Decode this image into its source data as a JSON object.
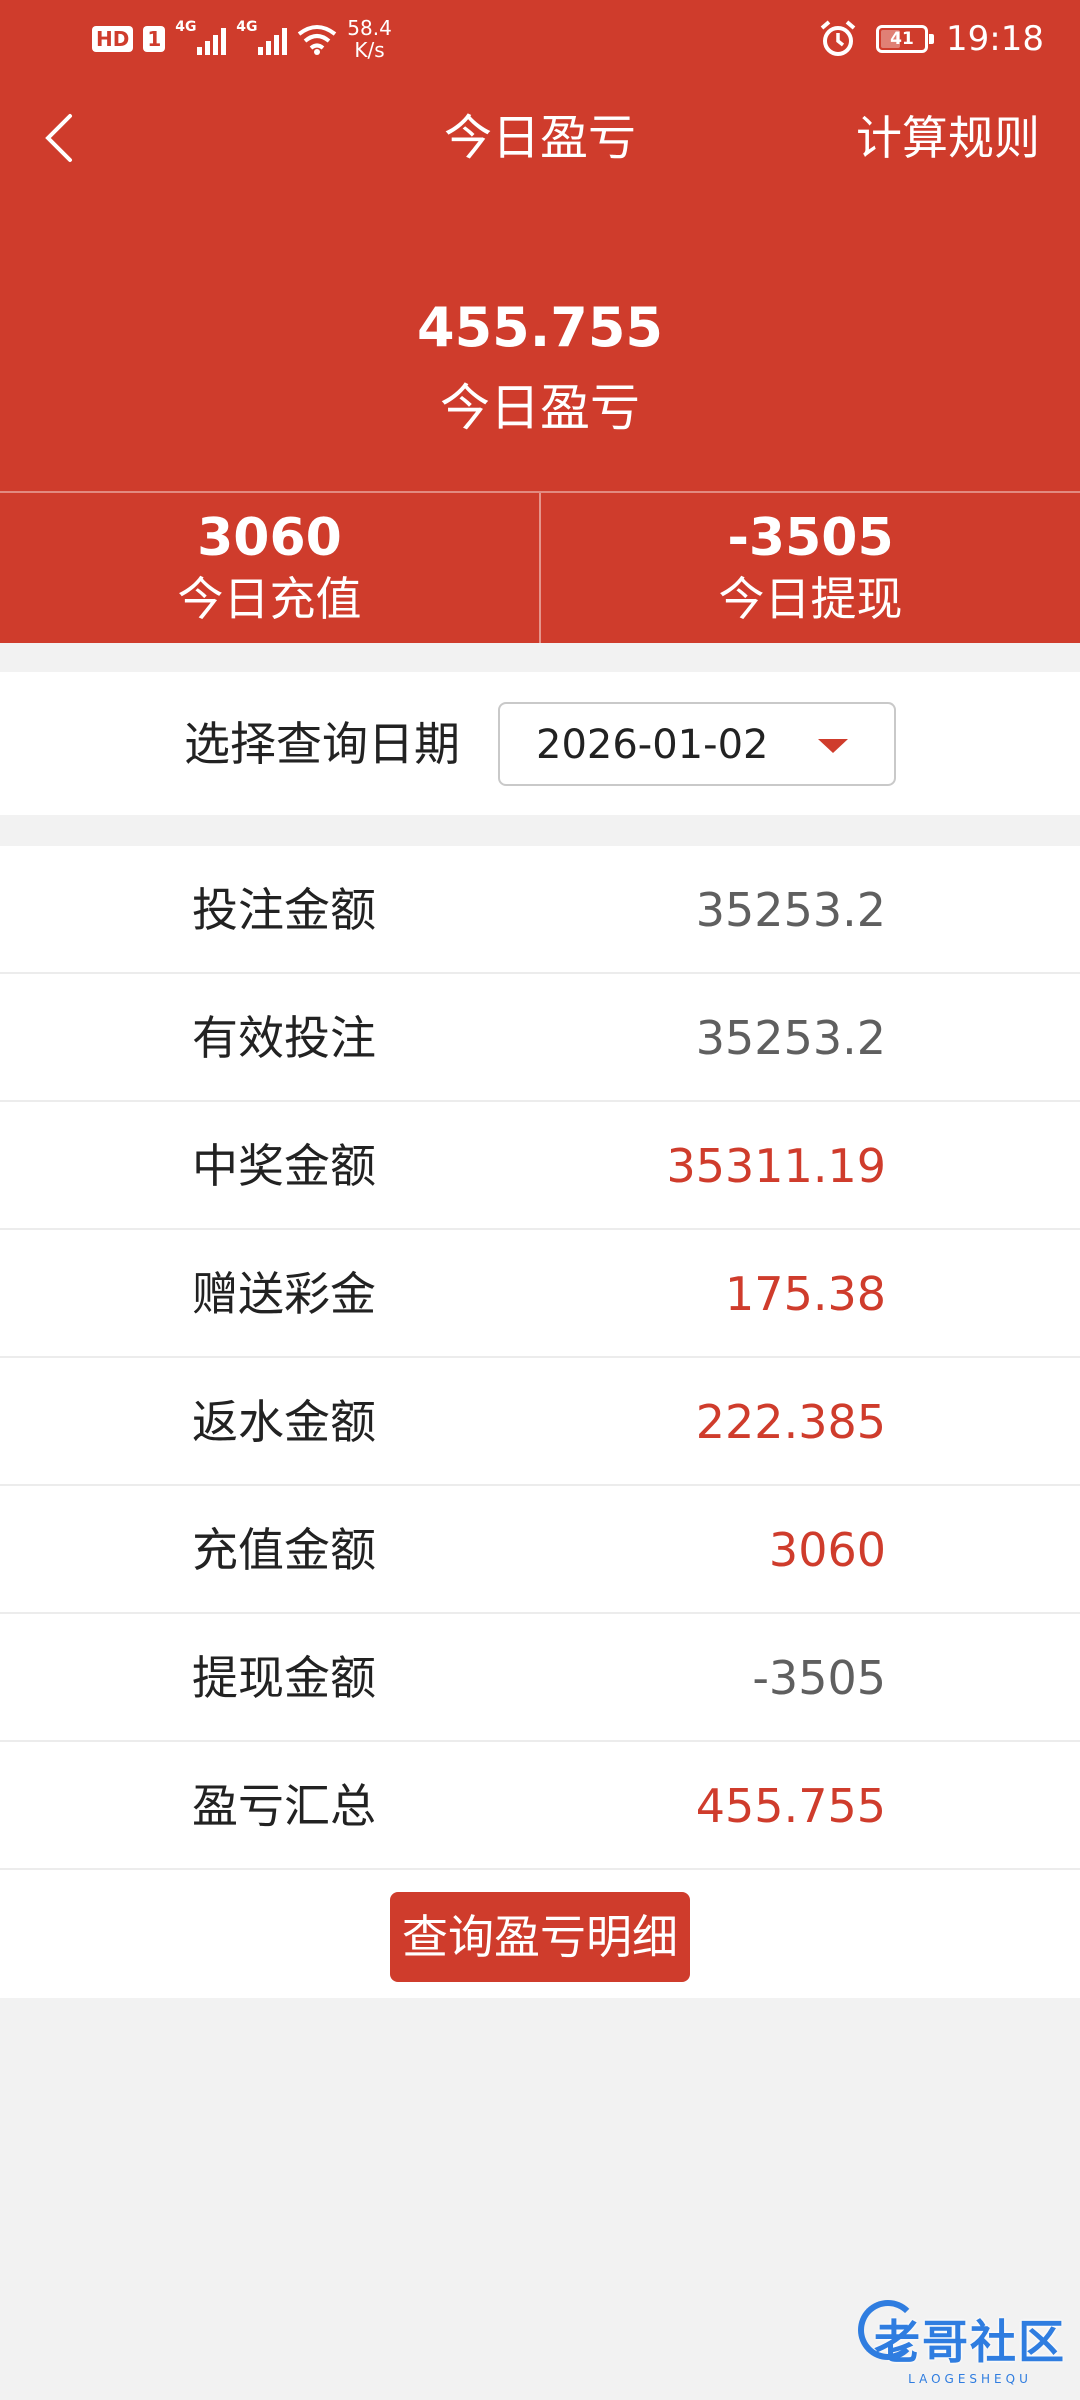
{
  "status_bar": {
    "hd_badge": "HD",
    "sim_badge": "1",
    "network_1": "4G",
    "network_2": "4G",
    "speed_value": "58.4",
    "speed_unit": "K/s",
    "battery": "41",
    "time": "19:18"
  },
  "header": {
    "title": "今日盈亏",
    "rules_link": "计算规则"
  },
  "summary": {
    "value": "455.755",
    "label": "今日盈亏"
  },
  "stats": [
    {
      "value": "3060",
      "label": "今日充值"
    },
    {
      "value": "-3505",
      "label": "今日提现"
    }
  ],
  "date_filter": {
    "label": "选择查询日期",
    "selected": "2026-01-02"
  },
  "rows": [
    {
      "label": "投注金额",
      "value": "35253.2",
      "color": "#5f5f5f"
    },
    {
      "label": "有效投注",
      "value": "35253.2",
      "color": "#5f5f5f"
    },
    {
      "label": "中奖金额",
      "value": "35311.19",
      "color": "#cf3c2c"
    },
    {
      "label": "赠送彩金",
      "value": "175.38",
      "color": "#cf3c2c"
    },
    {
      "label": "返水金额",
      "value": "222.385",
      "color": "#cf3c2c"
    },
    {
      "label": "充值金额",
      "value": "3060",
      "color": "#cf3c2c"
    },
    {
      "label": "提现金额",
      "value": "-3505",
      "color": "#5f5f5f"
    },
    {
      "label": "盈亏汇总",
      "value": "455.755",
      "color": "#cf3c2c"
    }
  ],
  "detail_button": "查询盈亏明细",
  "watermark": {
    "text": "老哥社区",
    "sub": "LAOGESHEQU"
  },
  "colors": {
    "primary": "#cf3c2c",
    "background": "#f2f2f2"
  }
}
